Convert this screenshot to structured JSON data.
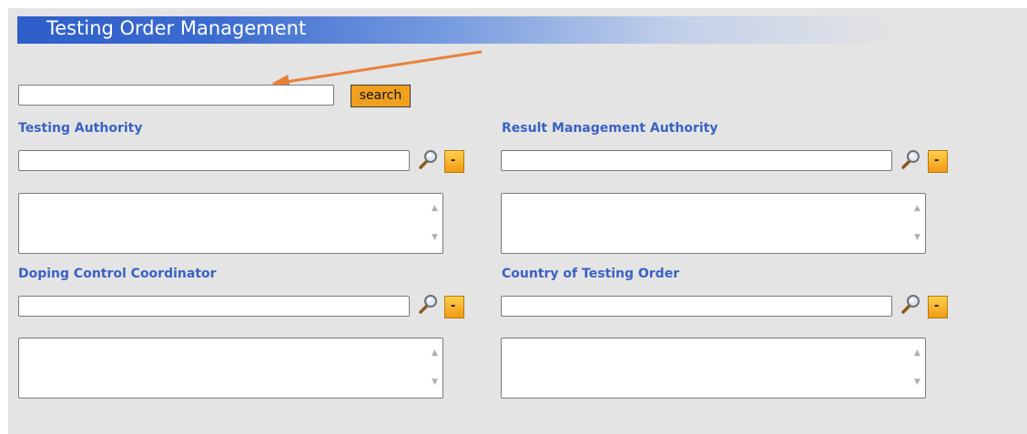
{
  "page": {
    "title": "Testing Order Management",
    "search": {
      "button_label": "search",
      "value": ""
    }
  },
  "sections": {
    "testing_authority": {
      "label": "Testing Authority",
      "value": ""
    },
    "result_management_authority": {
      "label": "Result Management Authority",
      "value": ""
    },
    "doping_control_coordinator": {
      "label": "Doping Control Coordinator",
      "value": ""
    },
    "country_of_testing_order": {
      "label": "Country of Testing Order",
      "value": ""
    }
  },
  "controls": {
    "remove_glyph": "-",
    "scroll_up_glyph": "▲",
    "scroll_down_glyph": "▼"
  },
  "icons": {
    "lookup": "magnifier-icon",
    "remove": "minus-icon"
  },
  "colors": {
    "title_bar_start": "#2d5ec9",
    "label": "#3a62c4",
    "search_button": "#f0a01e",
    "annotation_arrow": "#e8823a",
    "panel": "#e4e4e4"
  }
}
